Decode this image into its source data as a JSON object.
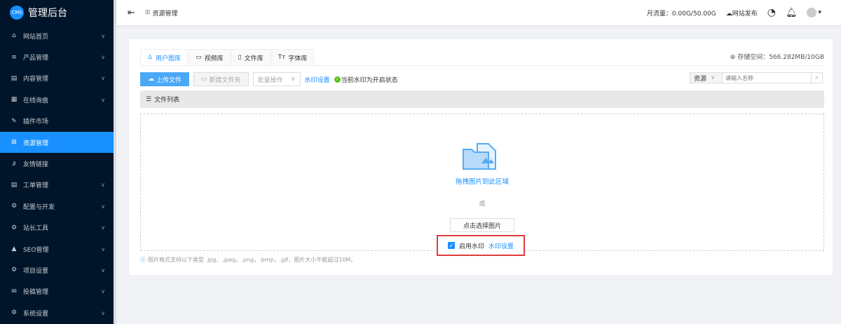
{
  "app": {
    "logo_badge": "CMS",
    "title": "管理后台"
  },
  "sidebar": {
    "items": [
      {
        "label": "网站首页",
        "icon": "home-icon",
        "chev": true
      },
      {
        "label": "产品管理",
        "icon": "product-icon",
        "chev": true
      },
      {
        "label": "内容管理",
        "icon": "content-icon",
        "chev": true
      },
      {
        "label": "在线询盘",
        "icon": "table-icon",
        "chev": true
      },
      {
        "label": "插件市场",
        "icon": "pin-icon",
        "chev": false
      },
      {
        "label": "资源管理",
        "icon": "grid-icon",
        "chev": false,
        "active": true
      },
      {
        "label": "友情链接",
        "icon": "link-icon",
        "chev": false
      },
      {
        "label": "工单管理",
        "icon": "ticket-icon",
        "chev": true
      },
      {
        "label": "配置与开发",
        "icon": "gear-icon",
        "chev": true
      },
      {
        "label": "站长工具",
        "icon": "tools-icon",
        "chev": true
      },
      {
        "label": "SEO管理",
        "icon": "warning-icon",
        "chev": true
      },
      {
        "label": "项目设置",
        "icon": "gear-icon",
        "chev": true
      },
      {
        "label": "投稿管理",
        "icon": "mail-icon",
        "chev": true
      },
      {
        "label": "系统设置",
        "icon": "gear-icon",
        "chev": true
      }
    ]
  },
  "header": {
    "breadcrumb": "资源管理",
    "traffic": "月流量：0.00G/50.00G",
    "publish": "网站发布"
  },
  "tabs": [
    "用户图库",
    "视频库",
    "文件库",
    "字体库"
  ],
  "storage": "存储空间：566.282MB/10GB",
  "toolbar": {
    "upload": "上传文件",
    "new_folder": "新建文件夹",
    "batch": "批量操作",
    "watermark_link": "水印设置",
    "watermark_status": "当前水印为开启状态"
  },
  "search": {
    "type": "资源",
    "placeholder": "请输入名称"
  },
  "list_title": "文件列表",
  "drop": {
    "title": "拖拽图片到此区域",
    "or": "或",
    "choose": "点击选择图片",
    "enable_watermark": "启用水印",
    "watermark_link": "水印设置"
  },
  "hint": "图片格式支持以下类型 .jpg，.jpeg，.png，.bmp，.gif，图片大小不能超过10M。"
}
